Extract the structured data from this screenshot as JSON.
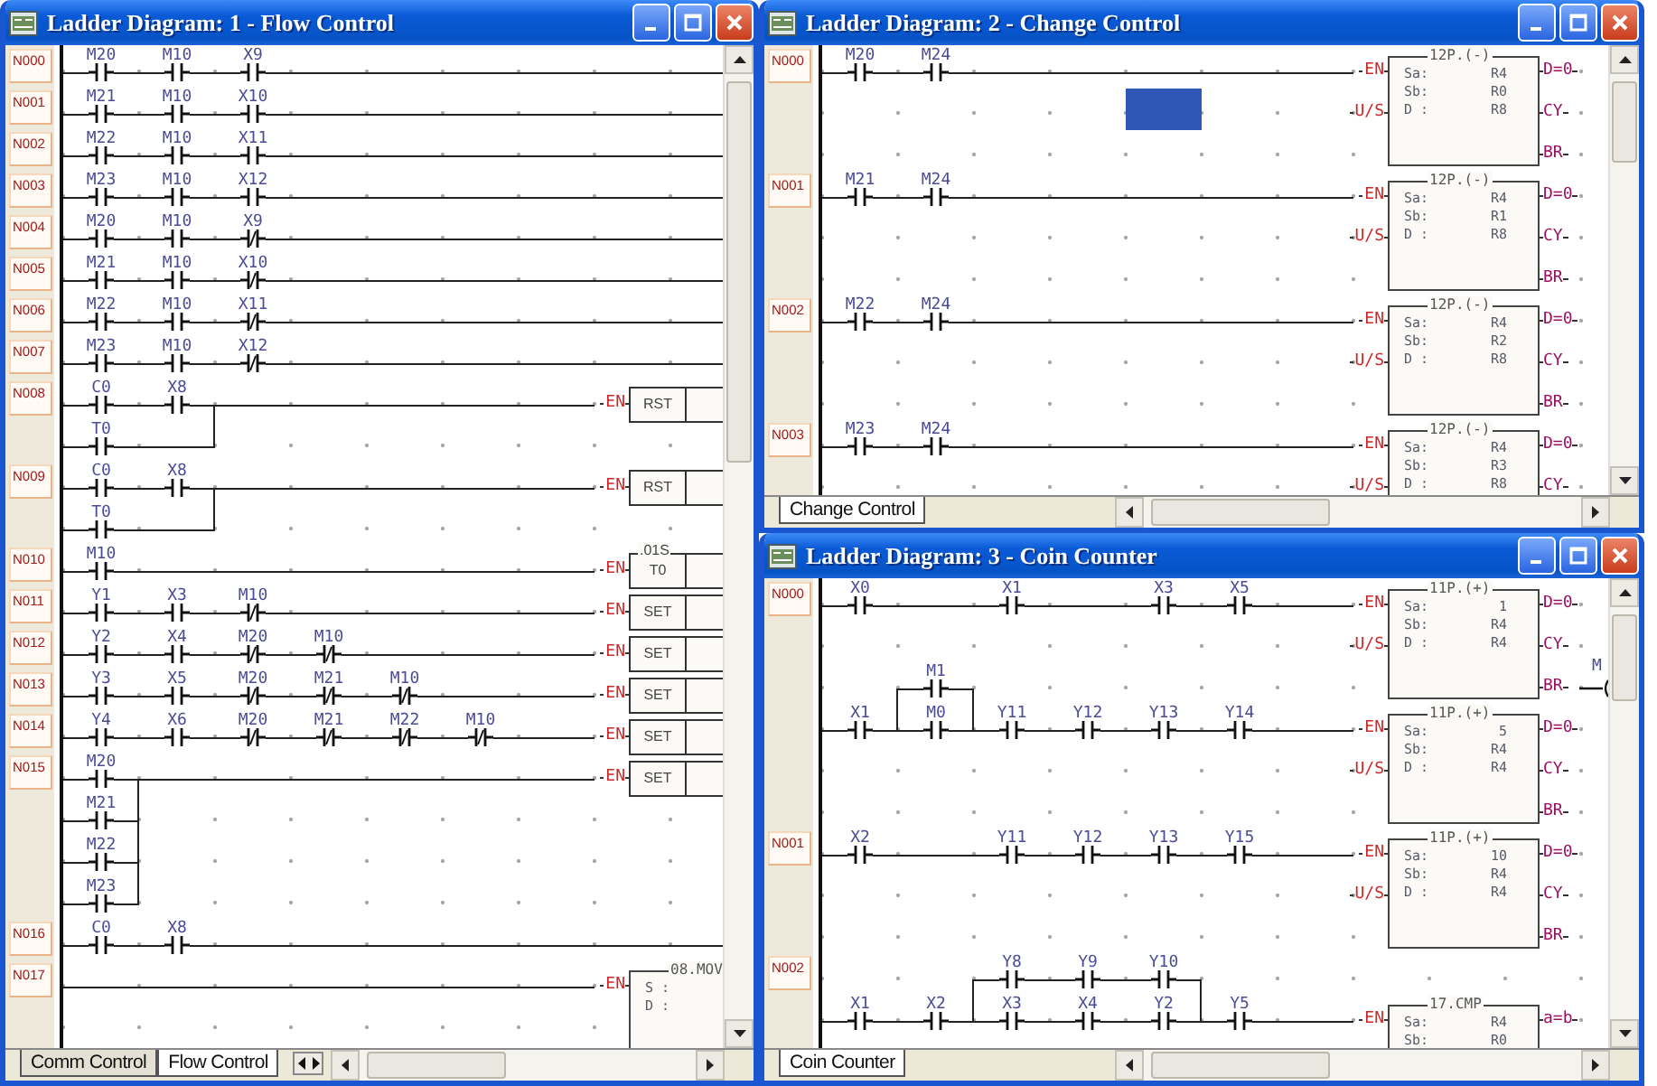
{
  "windows": [
    {
      "title": "Ladder Diagram: 1 - Flow Control",
      "tab_scroll_buttons": true,
      "rungs": [
        {
          "label": "N000",
          "lines": [
            {
              "kind": "main",
              "cells": [
                {
                  "kind": "no",
                  "label": "M20"
                },
                {
                  "kind": "no",
                  "label": "M10"
                },
                {
                  "kind": "no",
                  "label": "X9"
                }
              ]
            }
          ]
        },
        {
          "label": "N001",
          "lines": [
            {
              "kind": "main",
              "cells": [
                {
                  "kind": "no",
                  "label": "M21"
                },
                {
                  "kind": "no",
                  "label": "M10"
                },
                {
                  "kind": "no",
                  "label": "X10"
                }
              ]
            }
          ]
        },
        {
          "label": "N002",
          "lines": [
            {
              "kind": "main",
              "cells": [
                {
                  "kind": "no",
                  "label": "M22"
                },
                {
                  "kind": "no",
                  "label": "M10"
                },
                {
                  "kind": "no",
                  "label": "X11"
                }
              ]
            }
          ]
        },
        {
          "label": "N003",
          "lines": [
            {
              "kind": "main",
              "cells": [
                {
                  "kind": "no",
                  "label": "M23"
                },
                {
                  "kind": "no",
                  "label": "M10"
                },
                {
                  "kind": "no",
                  "label": "X12"
                }
              ]
            }
          ]
        },
        {
          "label": "N004",
          "lines": [
            {
              "kind": "main",
              "cells": [
                {
                  "kind": "no",
                  "label": "M20"
                },
                {
                  "kind": "no",
                  "label": "M10"
                },
                {
                  "kind": "nc",
                  "label": "X9"
                }
              ]
            }
          ]
        },
        {
          "label": "N005",
          "lines": [
            {
              "kind": "main",
              "cells": [
                {
                  "kind": "no",
                  "label": "M21"
                },
                {
                  "kind": "no",
                  "label": "M10"
                },
                {
                  "kind": "nc",
                  "label": "X10"
                }
              ]
            }
          ]
        },
        {
          "label": "N006",
          "lines": [
            {
              "kind": "main",
              "cells": [
                {
                  "kind": "no",
                  "label": "M22"
                },
                {
                  "kind": "no",
                  "label": "M10"
                },
                {
                  "kind": "nc",
                  "label": "X11"
                }
              ]
            }
          ]
        },
        {
          "label": "N007",
          "lines": [
            {
              "kind": "main",
              "cells": [
                {
                  "kind": "no",
                  "label": "M23"
                },
                {
                  "kind": "no",
                  "label": "M10"
                },
                {
                  "kind": "nc",
                  "label": "X12"
                }
              ]
            }
          ]
        },
        {
          "label": "N008",
          "lines": [
            {
              "kind": "main",
              "cells": [
                {
                  "kind": "no",
                  "label": "C0"
                },
                {
                  "kind": "no",
                  "label": "X8"
                }
              ],
              "output": {
                "kind": "box",
                "left_pins": [
                  "EN"
                ],
                "name": "RST"
              }
            },
            {
              "kind": "branch",
              "cells": [
                {
                  "kind": "no",
                  "label": "T0"
                },
                {
                  "kind": "wire"
                }
              ]
            }
          ]
        },
        {
          "label": "N009",
          "lines": [
            {
              "kind": "main",
              "cells": [
                {
                  "kind": "no",
                  "label": "C0"
                },
                {
                  "kind": "no",
                  "label": "X8"
                }
              ],
              "output": {
                "kind": "box",
                "left_pins": [
                  "EN"
                ],
                "name": "RST"
              }
            },
            {
              "kind": "branch",
              "cells": [
                {
                  "kind": "no",
                  "label": "T0"
                },
                {
                  "kind": "wire"
                }
              ]
            }
          ]
        },
        {
          "label": "N010",
          "lines": [
            {
              "kind": "main",
              "cells": [
                {
                  "kind": "no",
                  "label": "M10"
                }
              ],
              "output": {
                "kind": "timer",
                "left_pins": [
                  "EN"
                ],
                "top": ".01S",
                "name": "T0"
              }
            }
          ]
        },
        {
          "label": "N011",
          "lines": [
            {
              "kind": "main",
              "cells": [
                {
                  "kind": "no",
                  "label": "Y1"
                },
                {
                  "kind": "no",
                  "label": "X3"
                },
                {
                  "kind": "nc",
                  "label": "M10"
                }
              ],
              "output": {
                "kind": "box",
                "left_pins": [
                  "EN"
                ],
                "name": "SET"
              }
            }
          ]
        },
        {
          "label": "N012",
          "lines": [
            {
              "kind": "main",
              "cells": [
                {
                  "kind": "no",
                  "label": "Y2"
                },
                {
                  "kind": "no",
                  "label": "X4"
                },
                {
                  "kind": "nc",
                  "label": "M20"
                },
                {
                  "kind": "nc",
                  "label": "M10"
                }
              ],
              "output": {
                "kind": "box",
                "left_pins": [
                  "EN"
                ],
                "name": "SET"
              }
            }
          ]
        },
        {
          "label": "N013",
          "lines": [
            {
              "kind": "main",
              "cells": [
                {
                  "kind": "no",
                  "label": "Y3"
                },
                {
                  "kind": "no",
                  "label": "X5"
                },
                {
                  "kind": "nc",
                  "label": "M20"
                },
                {
                  "kind": "nc",
                  "label": "M21"
                },
                {
                  "kind": "nc",
                  "label": "M10"
                }
              ],
              "output": {
                "kind": "box",
                "left_pins": [
                  "EN"
                ],
                "name": "SET"
              }
            }
          ]
        },
        {
          "label": "N014",
          "lines": [
            {
              "kind": "main",
              "cells": [
                {
                  "kind": "no",
                  "label": "Y4"
                },
                {
                  "kind": "no",
                  "label": "X6"
                },
                {
                  "kind": "nc",
                  "label": "M20"
                },
                {
                  "kind": "nc",
                  "label": "M21"
                },
                {
                  "kind": "nc",
                  "label": "M22"
                },
                {
                  "kind": "nc",
                  "label": "M10"
                }
              ],
              "output": {
                "kind": "box",
                "left_pins": [
                  "EN"
                ],
                "name": "SET"
              }
            }
          ]
        },
        {
          "label": "N015",
          "lines": [
            {
              "kind": "main",
              "cells": [
                {
                  "kind": "no",
                  "label": "M20"
                }
              ],
              "output": {
                "kind": "box",
                "left_pins": [
                  "EN"
                ],
                "name": "SET"
              }
            },
            {
              "kind": "branch",
              "cells": [
                {
                  "kind": "no",
                  "label": "M21"
                }
              ]
            },
            {
              "kind": "branch",
              "cells": [
                {
                  "kind": "no",
                  "label": "M22"
                }
              ]
            },
            {
              "kind": "branch",
              "cells": [
                {
                  "kind": "no",
                  "label": "M23"
                }
              ]
            }
          ]
        },
        {
          "label": "N016",
          "lines": [
            {
              "kind": "main",
              "cells": [
                {
                  "kind": "no",
                  "label": "C0"
                },
                {
                  "kind": "no",
                  "label": "X8"
                }
              ]
            }
          ]
        },
        {
          "label": "N017",
          "lines": [
            {
              "kind": "main",
              "output": {
                "kind": "func",
                "left_pins": [
                  "EN"
                ],
                "top": "08.MOV",
                "params": [
                  {
                    "name": "S :"
                  },
                  {
                    "name": "D :"
                  }
                ]
              }
            }
          ]
        }
      ],
      "tabs": [
        {
          "label": "Comm Control",
          "selected": false
        },
        {
          "label": "Flow Control",
          "selected": true
        }
      ]
    },
    {
      "title": "Ladder Diagram: 2 - Change Control",
      "tab_scroll_buttons": false,
      "rungs": [
        {
          "label": "N000",
          "lines": [
            {
              "kind": "main",
              "cells": [
                {
                  "kind": "no",
                  "label": "M20"
                },
                {
                  "kind": "no",
                  "label": "M24"
                }
              ],
              "output": {
                "kind": "func",
                "left_pins": [
                  "EN",
                  "U/S"
                ],
                "top": "12P.(-)",
                "params": [
                  {
                    "name": "Sa:",
                    "value": "R4"
                  },
                  {
                    "name": "Sb:",
                    "value": "R0"
                  },
                  {
                    "name": "D :",
                    "value": "R8"
                  }
                ],
                "right_pins": [
                  "D=0",
                  "CY",
                  "BR"
                ]
              }
            },
            {
              "kind": "gap",
              "cells": [
                {
                  "kind": "blank"
                },
                {
                  "kind": "blank"
                },
                {
                  "kind": "blank"
                },
                {
                  "kind": "blank"
                },
                {
                  "kind": "cursor"
                }
              ]
            },
            {
              "kind": "gap"
            }
          ]
        },
        {
          "label": "N001",
          "lines": [
            {
              "kind": "main",
              "cells": [
                {
                  "kind": "no",
                  "label": "M21"
                },
                {
                  "kind": "no",
                  "label": "M24"
                }
              ],
              "output": {
                "kind": "func",
                "left_pins": [
                  "EN",
                  "U/S"
                ],
                "top": "12P.(-)",
                "params": [
                  {
                    "name": "Sa:",
                    "value": "R4"
                  },
                  {
                    "name": "Sb:",
                    "value": "R1"
                  },
                  {
                    "name": "D :",
                    "value": "R8"
                  }
                ],
                "right_pins": [
                  "D=0",
                  "CY",
                  "BR"
                ]
              }
            },
            {
              "kind": "gap"
            },
            {
              "kind": "gap"
            }
          ]
        },
        {
          "label": "N002",
          "lines": [
            {
              "kind": "main",
              "cells": [
                {
                  "kind": "no",
                  "label": "M22"
                },
                {
                  "kind": "no",
                  "label": "M24"
                }
              ],
              "output": {
                "kind": "func",
                "left_pins": [
                  "EN",
                  "U/S"
                ],
                "top": "12P.(-)",
                "params": [
                  {
                    "name": "Sa:",
                    "value": "R4"
                  },
                  {
                    "name": "Sb:",
                    "value": "R2"
                  },
                  {
                    "name": "D :",
                    "value": "R8"
                  }
                ],
                "right_pins": [
                  "D=0",
                  "CY",
                  "BR"
                ]
              }
            },
            {
              "kind": "gap"
            },
            {
              "kind": "gap"
            }
          ]
        },
        {
          "label": "N003",
          "lines": [
            {
              "kind": "main",
              "cells": [
                {
                  "kind": "no",
                  "label": "M23"
                },
                {
                  "kind": "no",
                  "label": "M24"
                }
              ],
              "output": {
                "kind": "func",
                "left_pins": [
                  "EN",
                  "U/S"
                ],
                "top": "12P.(-)",
                "params": [
                  {
                    "name": "Sa:",
                    "value": "R4"
                  },
                  {
                    "name": "Sb:",
                    "value": "R3"
                  },
                  {
                    "name": "D :",
                    "value": "R8"
                  }
                ],
                "right_pins": [
                  "D=0",
                  "CY"
                ]
              }
            }
          ]
        }
      ],
      "tabs": [
        {
          "label": "Change Control",
          "selected": true
        }
      ]
    },
    {
      "title": "Ladder Diagram: 3 - Coin Counter",
      "tab_scroll_buttons": false,
      "rungs": [
        {
          "label": "N000",
          "lines": [
            {
              "kind": "main",
              "cells": [
                {
                  "kind": "no",
                  "label": "X0"
                },
                {
                  "kind": "wire"
                },
                {
                  "kind": "no",
                  "label": "X1"
                },
                {
                  "kind": "wire"
                },
                {
                  "kind": "no",
                  "label": "X3"
                },
                {
                  "kind": "no",
                  "label": "X5"
                }
              ],
              "output": {
                "kind": "func",
                "left_pins": [
                  "EN",
                  "U/S"
                ],
                "top": "11P.(+)",
                "params": [
                  {
                    "name": "Sa:",
                    "value": "1"
                  },
                  {
                    "name": "Sb:",
                    "value": "R4"
                  },
                  {
                    "name": "D :",
                    "value": "R4"
                  }
                ],
                "right_pins": [
                  "D=0",
                  "CY",
                  "BR"
                ],
                "coil": "M"
              }
            },
            {
              "kind": "gap"
            },
            {
              "kind": "branch_up",
              "cells": [
                {
                  "kind": "blank"
                },
                {
                  "kind": "no",
                  "label": "M1"
                }
              ]
            },
            {
              "kind": "main",
              "cells": [
                {
                  "kind": "no",
                  "label": "X1"
                },
                {
                  "kind": "no",
                  "label": "M0"
                },
                {
                  "kind": "no",
                  "label": "Y11"
                },
                {
                  "kind": "no",
                  "label": "Y12"
                },
                {
                  "kind": "no",
                  "label": "Y13"
                },
                {
                  "kind": "no",
                  "label": "Y14"
                }
              ],
              "output": {
                "kind": "func",
                "left_pins": [
                  "EN",
                  "U/S"
                ],
                "top": "11P.(+)",
                "params": [
                  {
                    "name": "Sa:",
                    "value": "5"
                  },
                  {
                    "name": "Sb:",
                    "value": "R4"
                  },
                  {
                    "name": "D :",
                    "value": "R4"
                  }
                ],
                "right_pins": [
                  "D=0",
                  "CY",
                  "BR"
                ]
              }
            },
            {
              "kind": "gap"
            },
            {
              "kind": "gap"
            }
          ]
        },
        {
          "label": "N001",
          "lines": [
            {
              "kind": "main",
              "cells": [
                {
                  "kind": "no",
                  "label": "X2"
                },
                {
                  "kind": "wire"
                },
                {
                  "kind": "no",
                  "label": "Y11"
                },
                {
                  "kind": "no",
                  "label": "Y12"
                },
                {
                  "kind": "no",
                  "label": "Y13"
                },
                {
                  "kind": "no",
                  "label": "Y15"
                }
              ],
              "output": {
                "kind": "func",
                "left_pins": [
                  "EN",
                  "U/S"
                ],
                "top": "11P.(+)",
                "params": [
                  {
                    "name": "Sa:",
                    "value": "10"
                  },
                  {
                    "name": "Sb:",
                    "value": "R4"
                  },
                  {
                    "name": "D :",
                    "value": "R4"
                  }
                ],
                "right_pins": [
                  "D=0",
                  "CY",
                  "BR"
                ]
              }
            },
            {
              "kind": "gap"
            },
            {
              "kind": "gap"
            }
          ]
        },
        {
          "label": "N002",
          "lines": [
            {
              "kind": "branch_up",
              "cells": [
                {
                  "kind": "blank"
                },
                {
                  "kind": "blank"
                },
                {
                  "kind": "no",
                  "label": "Y8"
                },
                {
                  "kind": "no",
                  "label": "Y9"
                },
                {
                  "kind": "no",
                  "label": "Y10"
                }
              ]
            },
            {
              "kind": "main",
              "cells": [
                {
                  "kind": "no",
                  "label": "X1"
                },
                {
                  "kind": "no",
                  "label": "X2"
                },
                {
                  "kind": "no",
                  "label": "X3"
                },
                {
                  "kind": "no",
                  "label": "X4"
                },
                {
                  "kind": "no",
                  "label": "Y2"
                },
                {
                  "kind": "no",
                  "label": "Y5"
                }
              ],
              "output": {
                "kind": "func",
                "left_pins": [
                  "EN"
                ],
                "top": "17.CMP",
                "params": [
                  {
                    "name": "Sa:",
                    "value": "R4"
                  },
                  {
                    "name": "Sb:",
                    "value": "R0"
                  }
                ],
                "right_pins": [
                  "a=b"
                ]
              }
            }
          ]
        }
      ],
      "tabs": [
        {
          "label": "Coin Counter",
          "selected": true
        }
      ]
    }
  ]
}
